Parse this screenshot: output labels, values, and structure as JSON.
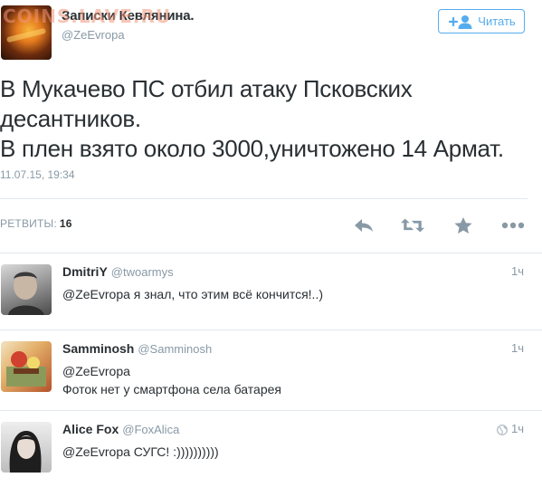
{
  "watermark": "COINS.LAVE.RU",
  "main_tweet": {
    "author_name": "Записки Кевлянина.",
    "author_handle": "@ZeEvropa",
    "follow_label": "Читать",
    "text_lines": [
      "В Мукачево ПС отбил атаку Псковских",
      "десантников.",
      "В плен взято около 3000,уничтожено 14 Армат."
    ],
    "timestamp": "11.07.15, 19:34",
    "retweets_label": "РЕТВИТЫ:",
    "retweets_count": "16",
    "actions": [
      "reply-icon",
      "retweet-icon",
      "favorite-icon",
      "more-icon"
    ]
  },
  "replies": [
    {
      "name": "DmitriY",
      "handle": "@twoarmys",
      "time": "1ч",
      "lines": [
        "@ZeEvropa я знал, что этим всё кончится!..)"
      ]
    },
    {
      "name": "Samminosh",
      "handle": "@Samminosh",
      "time": "1ч",
      "lines": [
        "@ZeEvropa",
        "Фоток нет у смартфона села батарея"
      ]
    },
    {
      "name": "Alice Fox",
      "handle": "@FoxAlica",
      "time": "1ч",
      "lines": [
        "@ZeEvropa СУГС! :))))))))))"
      ]
    }
  ],
  "colors": {
    "accent": "#55acee",
    "muted": "#8899a6",
    "icon": "#8899a6",
    "divider": "#e1e8ed"
  }
}
